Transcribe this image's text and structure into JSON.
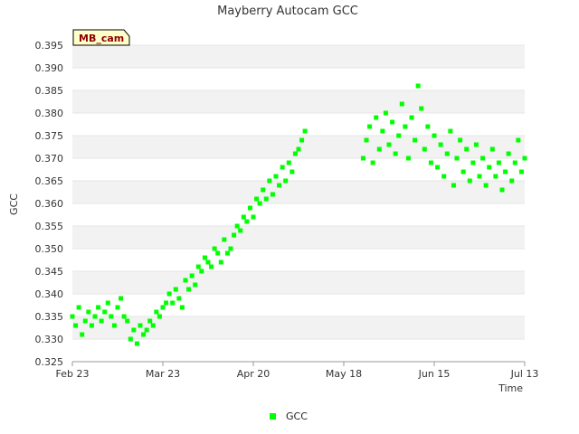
{
  "chart_data": {
    "type": "scatter",
    "title": "Mayberry Autocam GCC",
    "xlabel": "Time",
    "ylabel": "GCC",
    "tag": "MB_cam",
    "xlim": [
      "2022-02-23",
      "2022-07-13"
    ],
    "ylim": [
      0.325,
      0.395
    ],
    "x_ticks": [
      {
        "label": "Feb 23",
        "date": "2022-02-23"
      },
      {
        "label": "Mar 23",
        "date": "2022-03-23"
      },
      {
        "label": "Apr 20",
        "date": "2022-04-20"
      },
      {
        "label": "May 18",
        "date": "2022-05-18"
      },
      {
        "label": "Jun 15",
        "date": "2022-06-15"
      },
      {
        "label": "Jul 13",
        "date": "2022-07-13"
      }
    ],
    "y_ticks": [
      "0.325",
      "0.330",
      "0.335",
      "0.340",
      "0.345",
      "0.350",
      "0.355",
      "0.360",
      "0.365",
      "0.370",
      "0.375",
      "0.380",
      "0.385",
      "0.390",
      "0.395"
    ],
    "grid": "horizontal bands",
    "legend_position": "bottom-center",
    "series": [
      {
        "name": "GCC",
        "color": "#00ff00",
        "marker": "square",
        "points": [
          [
            "2022-02-23",
            0.335
          ],
          [
            "2022-02-24",
            0.333
          ],
          [
            "2022-02-25",
            0.337
          ],
          [
            "2022-02-26",
            0.331
          ],
          [
            "2022-02-27",
            0.334
          ],
          [
            "2022-02-28",
            0.336
          ],
          [
            "2022-03-01",
            0.333
          ],
          [
            "2022-03-02",
            0.335
          ],
          [
            "2022-03-03",
            0.337
          ],
          [
            "2022-03-04",
            0.334
          ],
          [
            "2022-03-05",
            0.336
          ],
          [
            "2022-03-06",
            0.338
          ],
          [
            "2022-03-07",
            0.335
          ],
          [
            "2022-03-08",
            0.333
          ],
          [
            "2022-03-09",
            0.337
          ],
          [
            "2022-03-10",
            0.339
          ],
          [
            "2022-03-11",
            0.335
          ],
          [
            "2022-03-12",
            0.334
          ],
          [
            "2022-03-13",
            0.33
          ],
          [
            "2022-03-14",
            0.332
          ],
          [
            "2022-03-15",
            0.329
          ],
          [
            "2022-03-16",
            0.333
          ],
          [
            "2022-03-17",
            0.331
          ],
          [
            "2022-03-18",
            0.332
          ],
          [
            "2022-03-19",
            0.334
          ],
          [
            "2022-03-20",
            0.333
          ],
          [
            "2022-03-21",
            0.336
          ],
          [
            "2022-03-22",
            0.335
          ],
          [
            "2022-03-23",
            0.337
          ],
          [
            "2022-03-24",
            0.338
          ],
          [
            "2022-03-25",
            0.34
          ],
          [
            "2022-03-26",
            0.338
          ],
          [
            "2022-03-27",
            0.341
          ],
          [
            "2022-03-28",
            0.339
          ],
          [
            "2022-03-29",
            0.337
          ],
          [
            "2022-03-30",
            0.343
          ],
          [
            "2022-03-31",
            0.341
          ],
          [
            "2022-04-01",
            0.344
          ],
          [
            "2022-04-02",
            0.342
          ],
          [
            "2022-04-03",
            0.346
          ],
          [
            "2022-04-04",
            0.345
          ],
          [
            "2022-04-05",
            0.348
          ],
          [
            "2022-04-06",
            0.347
          ],
          [
            "2022-04-07",
            0.346
          ],
          [
            "2022-04-08",
            0.35
          ],
          [
            "2022-04-09",
            0.349
          ],
          [
            "2022-04-10",
            0.347
          ],
          [
            "2022-04-11",
            0.352
          ],
          [
            "2022-04-12",
            0.349
          ],
          [
            "2022-04-13",
            0.35
          ],
          [
            "2022-04-14",
            0.353
          ],
          [
            "2022-04-15",
            0.355
          ],
          [
            "2022-04-16",
            0.354
          ],
          [
            "2022-04-17",
            0.357
          ],
          [
            "2022-04-18",
            0.356
          ],
          [
            "2022-04-19",
            0.359
          ],
          [
            "2022-04-20",
            0.357
          ],
          [
            "2022-04-21",
            0.361
          ],
          [
            "2022-04-22",
            0.36
          ],
          [
            "2022-04-23",
            0.363
          ],
          [
            "2022-04-24",
            0.361
          ],
          [
            "2022-04-25",
            0.365
          ],
          [
            "2022-04-26",
            0.362
          ],
          [
            "2022-04-27",
            0.366
          ],
          [
            "2022-04-28",
            0.364
          ],
          [
            "2022-04-29",
            0.368
          ],
          [
            "2022-04-30",
            0.365
          ],
          [
            "2022-05-01",
            0.369
          ],
          [
            "2022-05-02",
            0.367
          ],
          [
            "2022-05-03",
            0.371
          ],
          [
            "2022-05-04",
            0.372
          ],
          [
            "2022-05-05",
            0.374
          ],
          [
            "2022-05-06",
            0.376
          ],
          [
            "2022-05-24",
            0.37
          ],
          [
            "2022-05-25",
            0.374
          ],
          [
            "2022-05-26",
            0.377
          ],
          [
            "2022-05-27",
            0.369
          ],
          [
            "2022-05-28",
            0.379
          ],
          [
            "2022-05-29",
            0.372
          ],
          [
            "2022-05-30",
            0.376
          ],
          [
            "2022-05-31",
            0.38
          ],
          [
            "2022-06-01",
            0.373
          ],
          [
            "2022-06-02",
            0.378
          ],
          [
            "2022-06-03",
            0.371
          ],
          [
            "2022-06-04",
            0.375
          ],
          [
            "2022-06-05",
            0.382
          ],
          [
            "2022-06-06",
            0.377
          ],
          [
            "2022-06-07",
            0.37
          ],
          [
            "2022-06-08",
            0.379
          ],
          [
            "2022-06-09",
            0.374
          ],
          [
            "2022-06-10",
            0.386
          ],
          [
            "2022-06-11",
            0.381
          ],
          [
            "2022-06-12",
            0.372
          ],
          [
            "2022-06-13",
            0.377
          ],
          [
            "2022-06-14",
            0.369
          ],
          [
            "2022-06-15",
            0.375
          ],
          [
            "2022-06-16",
            0.368
          ],
          [
            "2022-06-17",
            0.373
          ],
          [
            "2022-06-18",
            0.366
          ],
          [
            "2022-06-19",
            0.371
          ],
          [
            "2022-06-20",
            0.376
          ],
          [
            "2022-06-21",
            0.364
          ],
          [
            "2022-06-22",
            0.37
          ],
          [
            "2022-06-23",
            0.374
          ],
          [
            "2022-06-24",
            0.367
          ],
          [
            "2022-06-25",
            0.372
          ],
          [
            "2022-06-26",
            0.365
          ],
          [
            "2022-06-27",
            0.369
          ],
          [
            "2022-06-28",
            0.373
          ],
          [
            "2022-06-29",
            0.366
          ],
          [
            "2022-06-30",
            0.37
          ],
          [
            "2022-07-01",
            0.364
          ],
          [
            "2022-07-02",
            0.368
          ],
          [
            "2022-07-03",
            0.372
          ],
          [
            "2022-07-04",
            0.366
          ],
          [
            "2022-07-05",
            0.369
          ],
          [
            "2022-07-06",
            0.363
          ],
          [
            "2022-07-07",
            0.367
          ],
          [
            "2022-07-08",
            0.371
          ],
          [
            "2022-07-09",
            0.365
          ],
          [
            "2022-07-10",
            0.369
          ],
          [
            "2022-07-11",
            0.374
          ],
          [
            "2022-07-12",
            0.367
          ],
          [
            "2022-07-13",
            0.37
          ]
        ]
      }
    ]
  }
}
